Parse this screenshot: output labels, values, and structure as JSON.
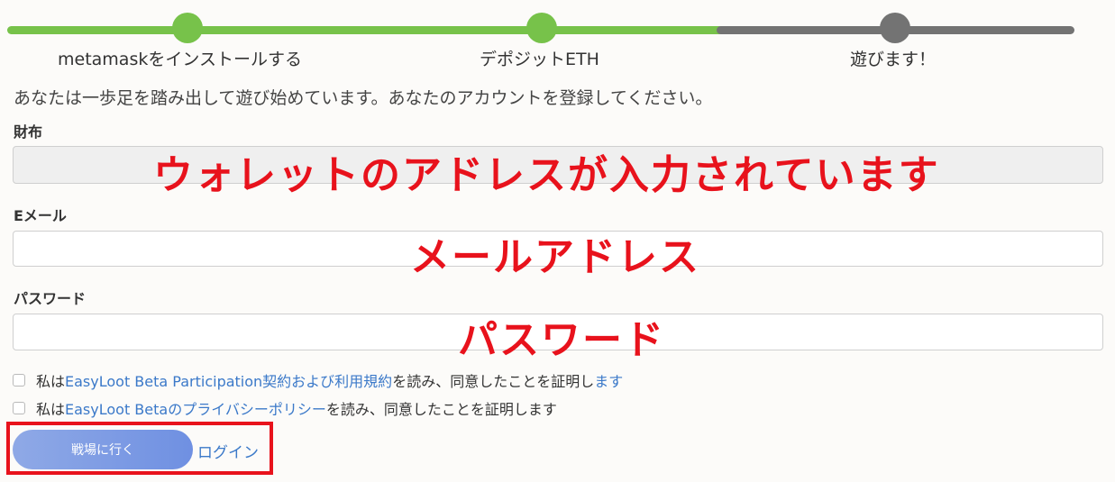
{
  "steps": [
    {
      "label": "metamaskをインストールする",
      "state": "done"
    },
    {
      "label": "デポジットETH",
      "state": "done"
    },
    {
      "label": "遊びます！",
      "state": "pending"
    }
  ],
  "colors": {
    "done": "#77c24a",
    "pending": "#737373",
    "link": "#3b79c9",
    "annotation": "#e8121c"
  },
  "intro": "あなたは一歩足を踏み出して遊び始めています。あなたのアカウントを登録してください。",
  "form": {
    "wallet_label": "財布",
    "wallet_value": "",
    "email_label": "Eメール",
    "email_value": "",
    "password_label": "パスワード",
    "password_value": ""
  },
  "annotations": {
    "wallet": "ウォレットのアドレスが入力されています",
    "email": "メールアドレス",
    "password": "パスワード"
  },
  "agreements": [
    {
      "prefix": "私は",
      "link": "EasyLoot Beta Participation契約および利用規約",
      "suffix": "を読み、同意したことを証明し",
      "suffix_link": "ます",
      "checked": false
    },
    {
      "prefix": "私は",
      "link": "EasyLoot Betaのプライバシーポリシー",
      "suffix": "を読み、同意したことを証明します",
      "checked": false
    }
  ],
  "actions": {
    "go_button": "戦場に行く",
    "login_link": "ログイン"
  }
}
